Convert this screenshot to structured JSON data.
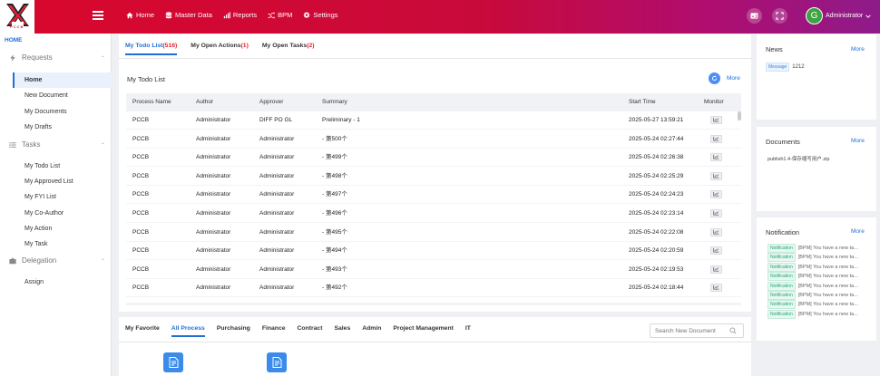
{
  "brand": {
    "logo_text": "PCCB"
  },
  "nav": [
    {
      "label": "Home",
      "icon": "home-icon"
    },
    {
      "label": "Master Data",
      "icon": "database-icon"
    },
    {
      "label": "Reports",
      "icon": "bar-chart-icon"
    },
    {
      "label": "BPM",
      "icon": "shuffle-icon"
    },
    {
      "label": "Settings",
      "icon": "gear-icon"
    }
  ],
  "user": {
    "name": "Administrator",
    "initial": "G"
  },
  "sidebar": {
    "home_label": "HOME",
    "requests": {
      "label": "Requests",
      "items": [
        {
          "label": "Home"
        },
        {
          "label": "New Document"
        },
        {
          "label": "My Documents"
        },
        {
          "label": "My Drafts"
        }
      ]
    },
    "tasks": {
      "label": "Tasks",
      "items": [
        {
          "label": "My Todo List"
        },
        {
          "label": "My Approved List"
        },
        {
          "label": "My FYI List"
        },
        {
          "label": "My Co-Author"
        },
        {
          "label": "My Action"
        },
        {
          "label": "My Task"
        }
      ]
    },
    "delegation": {
      "label": "Delegation",
      "items": [
        {
          "label": "Assign"
        }
      ]
    }
  },
  "main": {
    "tabs": [
      {
        "label": "My Todo List",
        "count": "(516)"
      },
      {
        "label": "My Open Actions",
        "count": "(1)"
      },
      {
        "label": "My Open Tasks",
        "count": "(2)"
      }
    ],
    "list_title": "My Todo List",
    "more": "More",
    "columns": [
      "Process Name",
      "Author",
      "Approver",
      "Summary",
      "Start Time",
      "Monitor"
    ],
    "rows": [
      {
        "process": "PCCB",
        "author": "Administrator",
        "approver": "DIFF PO GL",
        "summary": "Preliminary - 1",
        "start": "2025-05-27 13:59:21"
      },
      {
        "process": "PCCB",
        "author": "Administrator",
        "approver": "Administrator",
        "summary": "- 第500个",
        "start": "2025-05-24 02:27:44"
      },
      {
        "process": "PCCB",
        "author": "Administrator",
        "approver": "Administrator",
        "summary": "- 第499个",
        "start": "2025-05-24 02:26:38"
      },
      {
        "process": "PCCB",
        "author": "Administrator",
        "approver": "Administrator",
        "summary": "- 第498个",
        "start": "2025-05-24 02:25:29"
      },
      {
        "process": "PCCB",
        "author": "Administrator",
        "approver": "Administrator",
        "summary": "- 第497个",
        "start": "2025-05-24 02:24:23"
      },
      {
        "process": "PCCB",
        "author": "Administrator",
        "approver": "Administrator",
        "summary": "- 第496个",
        "start": "2025-05-24 02:23:14"
      },
      {
        "process": "PCCB",
        "author": "Administrator",
        "approver": "Administrator",
        "summary": "- 第495个",
        "start": "2025-05-24 02:22:08"
      },
      {
        "process": "PCCB",
        "author": "Administrator",
        "approver": "Administrator",
        "summary": "- 第494个",
        "start": "2025-05-24 02:20:59"
      },
      {
        "process": "PCCB",
        "author": "Administrator",
        "approver": "Administrator",
        "summary": "- 第493个",
        "start": "2025-05-24 02:19:53"
      },
      {
        "process": "PCCB",
        "author": "Administrator",
        "approver": "Administrator",
        "summary": "- 第492个",
        "start": "2025-05-24 02:18:44"
      }
    ]
  },
  "process": {
    "tabs": [
      "My Favorite",
      "All Process",
      "Purchasing",
      "Finance",
      "Contract",
      "Sales",
      "Admin",
      "Project Management",
      "IT"
    ],
    "active_tab": "All Process",
    "search_placeholder": "Search New Document"
  },
  "news": {
    "title": "News",
    "more": "More",
    "items": [
      {
        "tag": "Message",
        "text": "1212"
      }
    ]
  },
  "documents": {
    "title": "Documents",
    "more": "More",
    "items": [
      "publish1.4-保存缩写用户.zip"
    ]
  },
  "notification": {
    "title": "Notification",
    "more": "More",
    "items": [
      {
        "tag": "Notification",
        "text": "[BPM] You have a new ta..."
      },
      {
        "tag": "Notification",
        "text": "[BPM] You have a new ta..."
      },
      {
        "tag": "Notification",
        "text": "[BPM] You have a new ta..."
      },
      {
        "tag": "Notification",
        "text": "[BPM] You have a new ta..."
      },
      {
        "tag": "Notification",
        "text": "[BPM] You have a new ta..."
      },
      {
        "tag": "Notification",
        "text": "[BPM] You have a new ta..."
      },
      {
        "tag": "Notification",
        "text": "[BPM] You have a new ta..."
      },
      {
        "tag": "Notification",
        "text": "[BPM] You have a new ta..."
      }
    ]
  },
  "colors": {
    "brand_red": "#d9072c",
    "brand_purple": "#8e1b8a",
    "accent_blue": "#1f6fd6",
    "badge_red": "#e4202f"
  }
}
